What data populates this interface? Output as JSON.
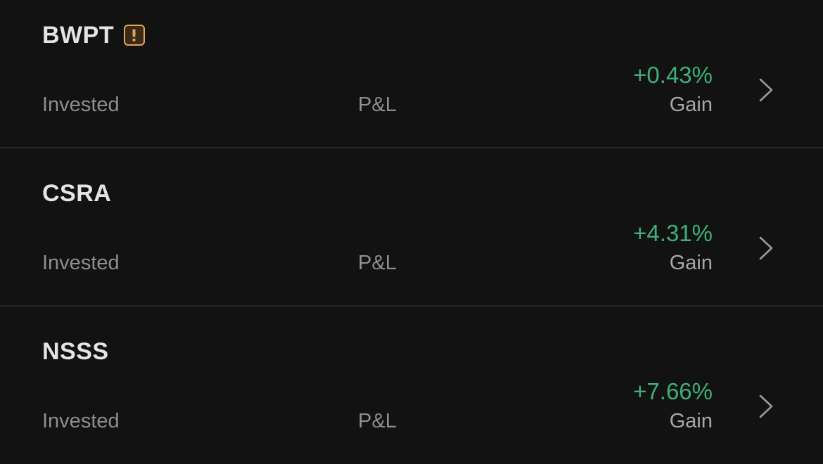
{
  "holdings": [
    {
      "ticker": "BWPT",
      "has_warning": true,
      "warning_icon": "exclamation-badge-icon",
      "invested_label": "Invested",
      "pnl_label": "P&L",
      "change_pct": "+0.43%",
      "change_label": "Gain",
      "chevron_icon": "chevron-right-icon"
    },
    {
      "ticker": "CSRA",
      "has_warning": false,
      "invested_label": "Invested",
      "pnl_label": "P&L",
      "change_pct": "+4.31%",
      "change_label": "Gain",
      "chevron_icon": "chevron-right-icon"
    },
    {
      "ticker": "NSSS",
      "has_warning": false,
      "invested_label": "Invested",
      "pnl_label": "P&L",
      "change_pct": "+7.66%",
      "change_label": "Gain",
      "chevron_icon": "chevron-right-icon"
    }
  ],
  "colors": {
    "background": "#121212",
    "gain": "#3db07a",
    "warning": "#e2a35a",
    "ticker_text": "#e4e4e4",
    "label_text": "#8e8e8e"
  }
}
